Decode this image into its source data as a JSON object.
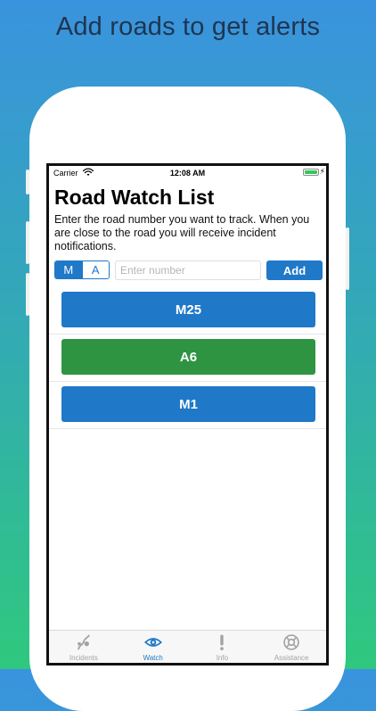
{
  "headline": "Add roads to get alerts",
  "status_bar": {
    "carrier": "Carrier",
    "time": "12:08 AM"
  },
  "page": {
    "title": "Road Watch List",
    "description": "Enter the road number you want to track. When you are close to the road you will receive incident notifications."
  },
  "road_type": {
    "options": [
      "M",
      "A"
    ],
    "selected": "M"
  },
  "road_input": {
    "value": "",
    "placeholder": "Enter number"
  },
  "add_label": "Add",
  "roads": [
    {
      "label": "M25",
      "color": "#1f78c8"
    },
    {
      "label": "A6",
      "color": "#2f9442"
    },
    {
      "label": "M1",
      "color": "#1f78c8"
    }
  ],
  "tabs": [
    {
      "label": "Incidents",
      "icon": "incidents-icon",
      "active": false
    },
    {
      "label": "Watch",
      "icon": "eye-icon",
      "active": true
    },
    {
      "label": "Info",
      "icon": "exclamation-icon",
      "active": false
    },
    {
      "label": "Assistance",
      "icon": "lifebuoy-icon",
      "active": false
    }
  ],
  "colors": {
    "accent": "#1f78c8",
    "green_road": "#2f9442",
    "tab_inactive": "#a3a3a3"
  }
}
